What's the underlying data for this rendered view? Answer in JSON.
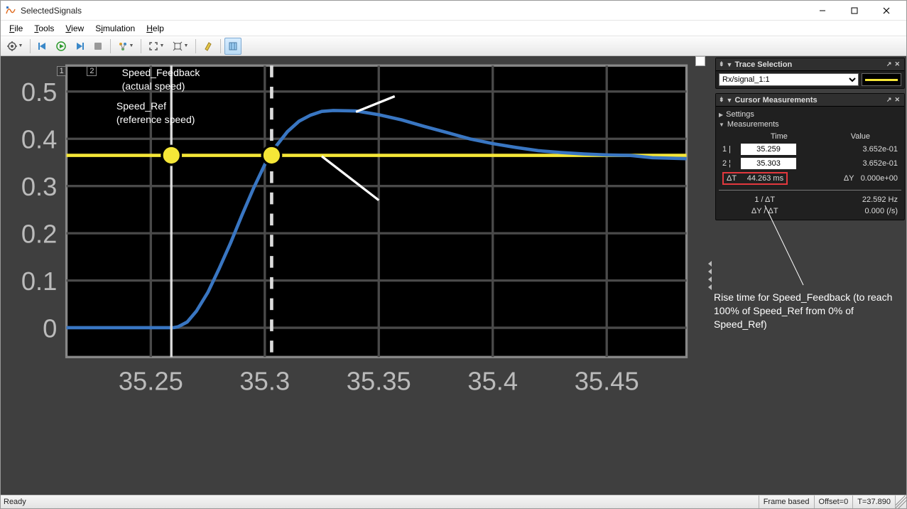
{
  "window": {
    "title": "SelectedSignals"
  },
  "menu": {
    "file": "File",
    "tools": "Tools",
    "view": "View",
    "simulation": "Simulation",
    "help": "Help"
  },
  "panels": {
    "trace": {
      "title": "Trace Selection",
      "selected": "Rx/signal_1:1"
    },
    "cursor": {
      "title": "Cursor Measurements",
      "settings": "Settings",
      "measurements": "Measurements",
      "hdr_time": "Time",
      "hdr_value": "Value",
      "row1_label": "1 |",
      "row1_time": "35.259",
      "row1_value": "3.652e-01",
      "row2_label": "2 ¦",
      "row2_time": "35.303",
      "row2_value": "3.652e-01",
      "dt_label": "ΔT",
      "dt_value": "44.263 ms",
      "dy_label": "ΔY",
      "dy_value": "0.000e+00",
      "inv_dt_label": "1 / ΔT",
      "inv_dt_value": "22.592 Hz",
      "slope_label": "ΔY / ΔT",
      "slope_value": "0.000 (/s)"
    }
  },
  "annotations": {
    "a1": "Speed_Feedback\n(actual speed)",
    "a2": "Speed_Ref\n(reference speed)",
    "a3": "Rise time for Speed_Feedback (to reach 100% of Speed_Ref from 0% of Speed_Ref)"
  },
  "status": {
    "ready": "Ready",
    "frame": "Frame based",
    "offset": "Offset=0",
    "time": "T=37.890"
  },
  "chart_data": {
    "type": "line",
    "xlim": [
      35.213,
      35.485
    ],
    "ylim": [
      -0.062,
      0.555
    ],
    "xticks": [
      35.25,
      35.3,
      35.35,
      35.4,
      35.45
    ],
    "yticks": [
      0,
      0.1,
      0.2,
      0.3,
      0.4,
      0.5
    ],
    "cursors": [
      {
        "id": 1,
        "x": 35.259,
        "y": 0.365
      },
      {
        "id": 2,
        "x": 35.303,
        "y": 0.365
      }
    ],
    "series": [
      {
        "name": "Speed_Ref",
        "color": "#f5e637",
        "y_const": 0.365,
        "x": [
          35.213,
          35.485
        ],
        "y": [
          0.365,
          0.365
        ]
      },
      {
        "name": "Speed_Feedback",
        "color": "#3976c2",
        "x": [
          35.213,
          35.22,
          35.23,
          35.24,
          35.25,
          35.26,
          35.262,
          35.266,
          35.27,
          35.275,
          35.28,
          35.285,
          35.29,
          35.295,
          35.3,
          35.305,
          35.31,
          35.315,
          35.32,
          35.325,
          35.33,
          35.34,
          35.35,
          35.36,
          35.37,
          35.38,
          35.39,
          35.4,
          35.41,
          35.42,
          35.43,
          35.44,
          35.45,
          35.46,
          35.47,
          35.485
        ],
        "y": [
          0.0,
          0.0,
          0.0,
          0.0,
          0.0,
          0.0,
          0.002,
          0.012,
          0.035,
          0.075,
          0.125,
          0.18,
          0.238,
          0.295,
          0.345,
          0.385,
          0.415,
          0.437,
          0.45,
          0.458,
          0.46,
          0.459,
          0.451,
          0.44,
          0.426,
          0.413,
          0.4,
          0.39,
          0.382,
          0.375,
          0.371,
          0.368,
          0.366,
          0.365,
          0.36,
          0.358
        ]
      }
    ]
  }
}
